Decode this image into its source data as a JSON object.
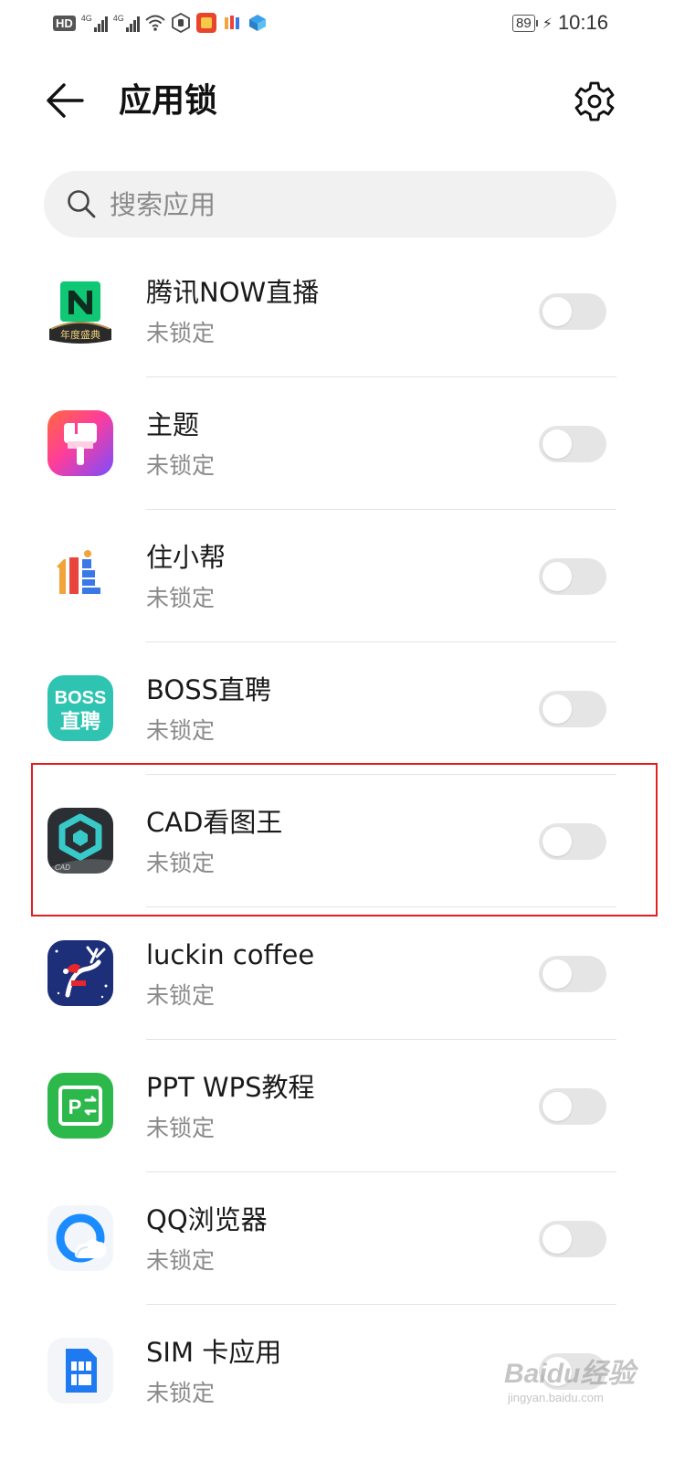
{
  "status_bar": {
    "hd_label": "HD",
    "network_1": "4G",
    "network_2": "4G",
    "battery": "89",
    "time": "10:16"
  },
  "header": {
    "title": "应用锁",
    "back_icon": "arrow-left-icon",
    "settings_icon": "gear-icon"
  },
  "search": {
    "placeholder": "搜索应用",
    "icon": "search-icon"
  },
  "apps": [
    {
      "name": "腾讯NOW直播",
      "status": "未锁定",
      "locked": false,
      "icon_badge": "年度盛典"
    },
    {
      "name": "主题",
      "status": "未锁定",
      "locked": false
    },
    {
      "name": "住小帮",
      "status": "未锁定",
      "locked": false
    },
    {
      "name": "BOSS直聘",
      "status": "未锁定",
      "locked": false,
      "icon_text": [
        "BOSS",
        "直聘"
      ]
    },
    {
      "name": "CAD看图王",
      "status": "未锁定",
      "locked": false,
      "icon_text": "CAD"
    },
    {
      "name": "luckin coffee",
      "status": "未锁定",
      "locked": false
    },
    {
      "name": "PPT WPS教程",
      "status": "未锁定",
      "locked": false,
      "icon_text": "P"
    },
    {
      "name": "QQ浏览器",
      "status": "未锁定",
      "locked": false
    },
    {
      "name": "SIM 卡应用",
      "status": "未锁定",
      "locked": false
    }
  ],
  "highlighted_app": "CAD看图王",
  "colors": {
    "highlight": "#e02020",
    "toggle_off": "#e5e5e5",
    "secondary_text": "#8a8a8a"
  },
  "watermark": {
    "main": "Baidu经验",
    "sub": "jingyan.baidu.com"
  }
}
